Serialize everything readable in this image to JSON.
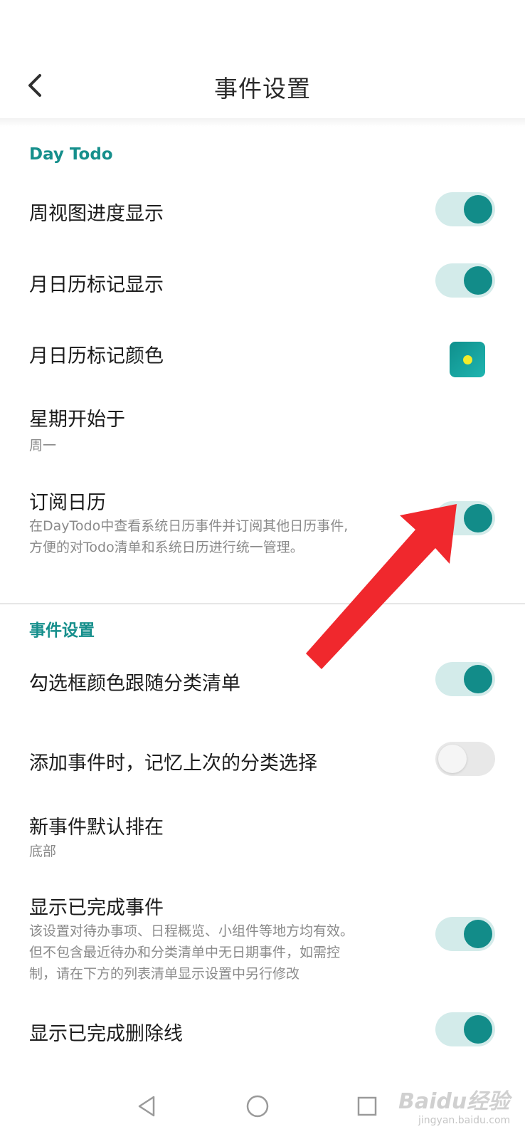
{
  "header": {
    "title": "事件设置",
    "back_icon": "chevron-left-icon"
  },
  "sections": [
    {
      "title": "Day Todo",
      "rows": [
        {
          "title": "周视图进度显示",
          "control": "toggle",
          "on": true
        },
        {
          "title": "月日历标记显示",
          "control": "toggle",
          "on": true
        },
        {
          "title": "月日历标记颜色",
          "control": "color",
          "color": "#128c89",
          "dot_color": "#f4ec2a"
        },
        {
          "title": "星期开始于",
          "subtitle": "周一"
        },
        {
          "title": "订阅日历",
          "subtitle_lines": [
            "在DayTodo中查看系统日历事件并订阅其他日历事件,",
            "方便的对Todo清单和系统日历进行统一管理。"
          ],
          "control": "toggle",
          "on": true
        }
      ]
    },
    {
      "title": "事件设置",
      "rows": [
        {
          "title": "勾选框颜色跟随分类清单",
          "control": "toggle",
          "on": true
        },
        {
          "title": "添加事件时，记忆上次的分类选择",
          "control": "toggle",
          "on": false
        },
        {
          "title": "新事件默认排在",
          "subtitle": "底部"
        },
        {
          "title": "显示已完成事件",
          "subtitle_lines": [
            "该设置对待办事项、日程概览、小组件等地方均有效。",
            "但不包含最近待办和分类清单中无日期事件，如需控",
            "制，请在下方的列表清单显示设置中另行修改"
          ],
          "control": "toggle",
          "on": true
        },
        {
          "title": "显示已完成删除线",
          "control": "toggle",
          "on": true
        }
      ]
    }
  ],
  "navbar": {
    "icons": [
      "nav-back-icon",
      "nav-home-icon",
      "nav-recents-icon"
    ]
  },
  "watermark": {
    "text": "Baidu经验",
    "sub": "jingyan.baidu.com"
  },
  "colors": {
    "accent": "#128c89",
    "section_title": "#168f8c",
    "toggle_track_on": "#d3ebea",
    "toggle_track_off": "#e8e8e8",
    "annotation_arrow": "#f0282d"
  }
}
